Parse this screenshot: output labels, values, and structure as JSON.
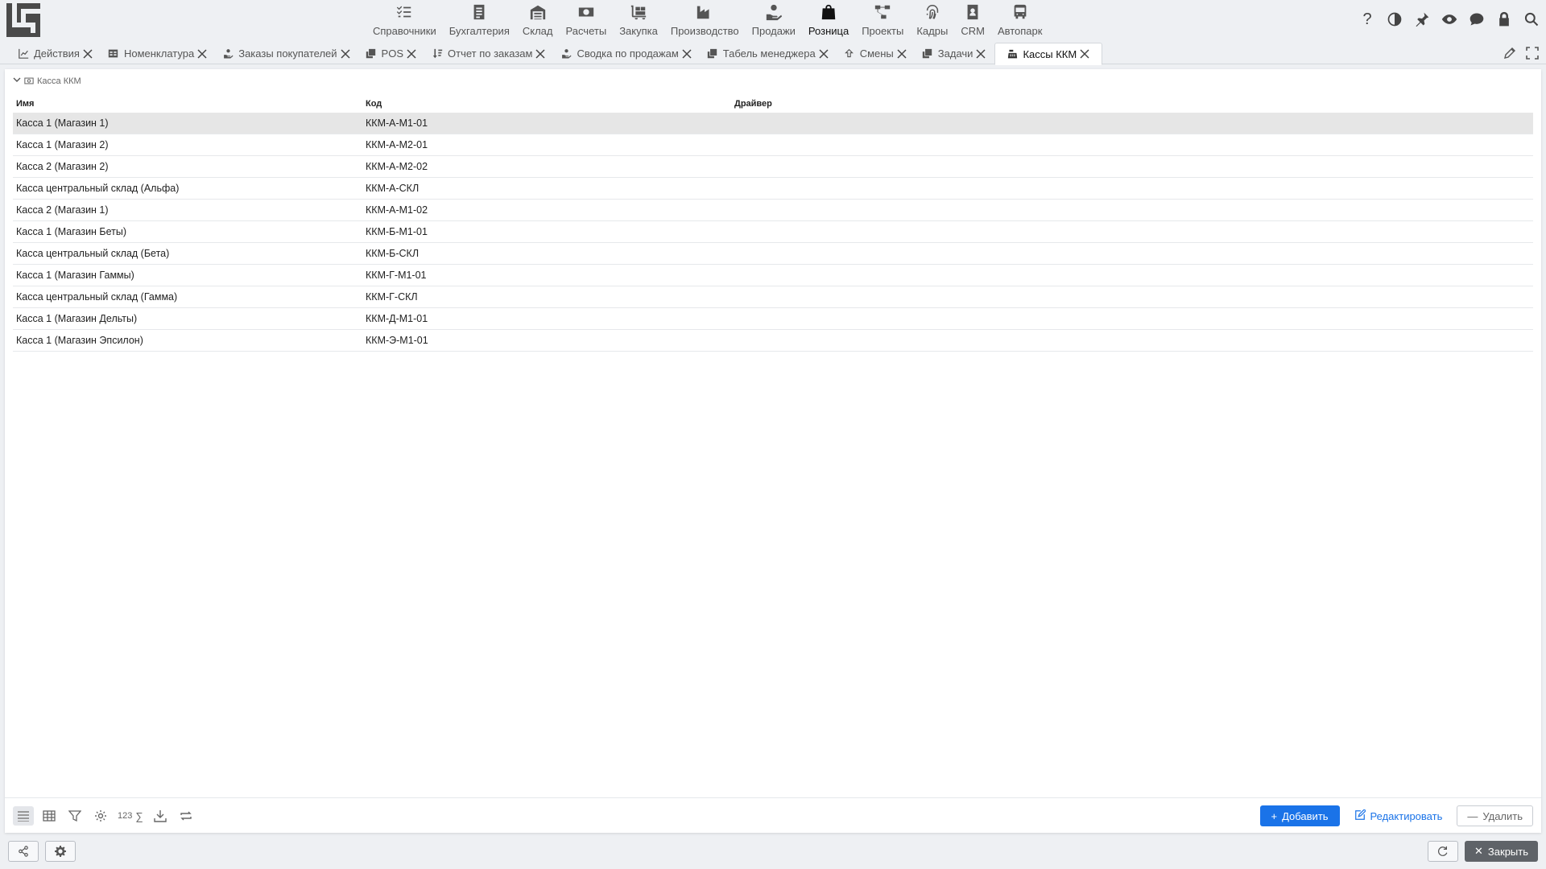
{
  "brand": {
    "logo": "app-logo"
  },
  "modules": [
    {
      "label": "Справочники",
      "icon": "list-check-icon"
    },
    {
      "label": "Бухгалтерия",
      "icon": "ledger-icon"
    },
    {
      "label": "Склад",
      "icon": "warehouse-icon"
    },
    {
      "label": "Расчеты",
      "icon": "money-icon"
    },
    {
      "label": "Закупка",
      "icon": "dolly-icon"
    },
    {
      "label": "Производство",
      "icon": "factory-icon"
    },
    {
      "label": "Продажи",
      "icon": "hand-holding-icon"
    },
    {
      "label": "Розница",
      "icon": "shopping-bag-icon",
      "active": true
    },
    {
      "label": "Проекты",
      "icon": "project-diagram-icon"
    },
    {
      "label": "Кадры",
      "icon": "fingerprint-icon"
    },
    {
      "label": "CRM",
      "icon": "contact-card-icon"
    },
    {
      "label": "Автопарк",
      "icon": "bus-icon"
    }
  ],
  "tabs": [
    {
      "label": "Действия",
      "icon": "chart-line-icon"
    },
    {
      "label": "Номенклатура",
      "icon": "table-icon"
    },
    {
      "label": "Заказы покупателей",
      "icon": "hand-holding-icon"
    },
    {
      "label": "POS",
      "icon": "copy-icon"
    },
    {
      "label": "Отчет по заказам",
      "icon": "sort-icon"
    },
    {
      "label": "Сводка по продажам",
      "icon": "hand-holding-icon"
    },
    {
      "label": "Табель менеджера",
      "icon": "copy-icon"
    },
    {
      "label": "Смены",
      "icon": "shift-icon"
    },
    {
      "label": "Задачи",
      "icon": "copy-icon"
    },
    {
      "label": "Кассы ККМ",
      "icon": "cash-register-icon",
      "active": true
    }
  ],
  "group": {
    "label": "Касса ККМ"
  },
  "grid": {
    "columns": [
      "Имя",
      "Код",
      "Драйвер"
    ],
    "rows": [
      [
        "Касса 1 (Магазин 1)",
        "ККМ-А-М1-01",
        ""
      ],
      [
        "Касса 1 (Магазин 2)",
        "ККМ-А-М2-01",
        ""
      ],
      [
        "Касса 2 (Магазин 2)",
        "ККМ-А-М2-02",
        ""
      ],
      [
        "Касса центральный склад (Альфа)",
        "ККМ-А-СКЛ",
        ""
      ],
      [
        "Касса 2 (Магазин 1)",
        "ККМ-А-М1-02",
        ""
      ],
      [
        "Касса 1 (Магазин Беты)",
        "ККМ-Б-М1-01",
        ""
      ],
      [
        "Касса центральный склад (Бета)",
        "ККМ-Б-СКЛ",
        ""
      ],
      [
        "Касса 1 (Магазин Гаммы)",
        "ККМ-Г-М1-01",
        ""
      ],
      [
        "Касса центральный склад (Гамма)",
        "ККМ-Г-СКЛ",
        ""
      ],
      [
        "Касса 1 (Магазин Дельты)",
        "ККМ-Д-М1-01",
        ""
      ],
      [
        "Касса 1 (Магазин Эпсилон)",
        "ККМ-Э-М1-01",
        ""
      ]
    ]
  },
  "toolbar": {
    "count_label": "123",
    "sum_label": "∑",
    "add_label": "Добавить",
    "edit_label": "Редактировать",
    "delete_label": "Удалить"
  },
  "footer": {
    "close_label": "Закрыть"
  },
  "colors": {
    "primary": "#1a73e8",
    "dark_button": "#5f6368",
    "selected_row": "#e6e6e6"
  }
}
